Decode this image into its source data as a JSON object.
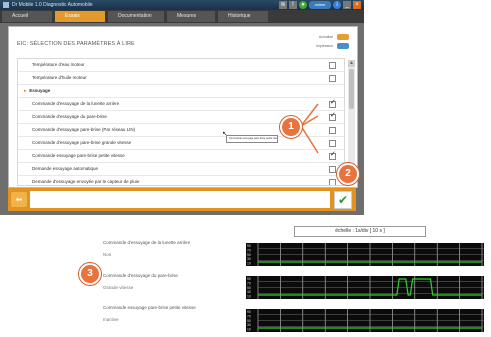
{
  "window": {
    "title": "Dr Mobile 1.0 Diagnostic Automobile"
  },
  "window_controls": {
    "status": "online"
  },
  "tabs": [
    {
      "label": "Accueil"
    },
    {
      "label": "Essais"
    },
    {
      "label": "Documentation"
    },
    {
      "label": "Mesures"
    },
    {
      "label": "Historique"
    }
  ],
  "panel": {
    "title": "EIC: SÉLECTION DES PARAMÈTRES À LIRE",
    "legend": [
      {
        "label": "Actualisé",
        "color": "#e2a033"
      },
      {
        "label": "Impression",
        "color": "#4a8fc9"
      }
    ]
  },
  "params": [
    {
      "label": "Température d'eau moteur",
      "type": "item",
      "checked": false
    },
    {
      "label": "Température d'huile moteur",
      "type": "item",
      "checked": false
    },
    {
      "label": "Essuyage",
      "type": "category"
    },
    {
      "label": "Commande d'essuyage de la lunette arrière",
      "type": "item",
      "checked": true
    },
    {
      "label": "Commande d'essuyage du pare-brise",
      "type": "item",
      "checked": true
    },
    {
      "label": "Commande d'essuyage pare-brise (Par réseau LIN)",
      "type": "item",
      "checked": false
    },
    {
      "label": "Commande d'essuyage pare-brise grande vitesse",
      "type": "item",
      "checked": false
    },
    {
      "label": "Commande essuyage pare-brise petite vitesse",
      "type": "item",
      "checked": true
    },
    {
      "label": "Demande essuyage automatique",
      "type": "item",
      "checked": false
    },
    {
      "label": "Demande d'essuyage envoyée par le capteur de pluie",
      "type": "item",
      "checked": false
    }
  ],
  "tooltip": "Commande essuyage pare-brise petite vitesse",
  "callouts": {
    "one": "1",
    "two": "2",
    "three": "3"
  },
  "scale_label": "échelle : 1s/div  [ 10 s ]",
  "graph_tick_labels": [
    "90",
    "70",
    "50",
    "30",
    "10"
  ],
  "signals": [
    {
      "name": "Commande d'essuyage de la lunette arrière",
      "value": "Non"
    },
    {
      "name": "Commande d'essuyage du pare-brise",
      "value": "Grande vitesse"
    },
    {
      "name": "Commande essuyage pare-brise petite vitesse",
      "value": "Inactive"
    }
  ],
  "chart_data": {
    "type": "line",
    "x_unit": "s",
    "y_tick_labels": [
      "90",
      "70",
      "50",
      "30",
      "10"
    ],
    "series": [
      {
        "name": "Commande d'essuyage de la lunette arrière",
        "points": [
          [
            0,
            0
          ],
          [
            10,
            0
          ]
        ]
      },
      {
        "name": "Commande d'essuyage du pare-brise",
        "points": [
          [
            0,
            0
          ],
          [
            6.2,
            0
          ],
          [
            6.3,
            1
          ],
          [
            6.6,
            1
          ],
          [
            6.7,
            0
          ],
          [
            6.8,
            0
          ],
          [
            6.9,
            1
          ],
          [
            7.7,
            1
          ],
          [
            7.8,
            0
          ],
          [
            10,
            0
          ]
        ]
      },
      {
        "name": "Commande essuyage pare-brise petite vitesse",
        "points": [
          [
            0,
            0
          ],
          [
            10,
            0
          ]
        ]
      }
    ]
  }
}
